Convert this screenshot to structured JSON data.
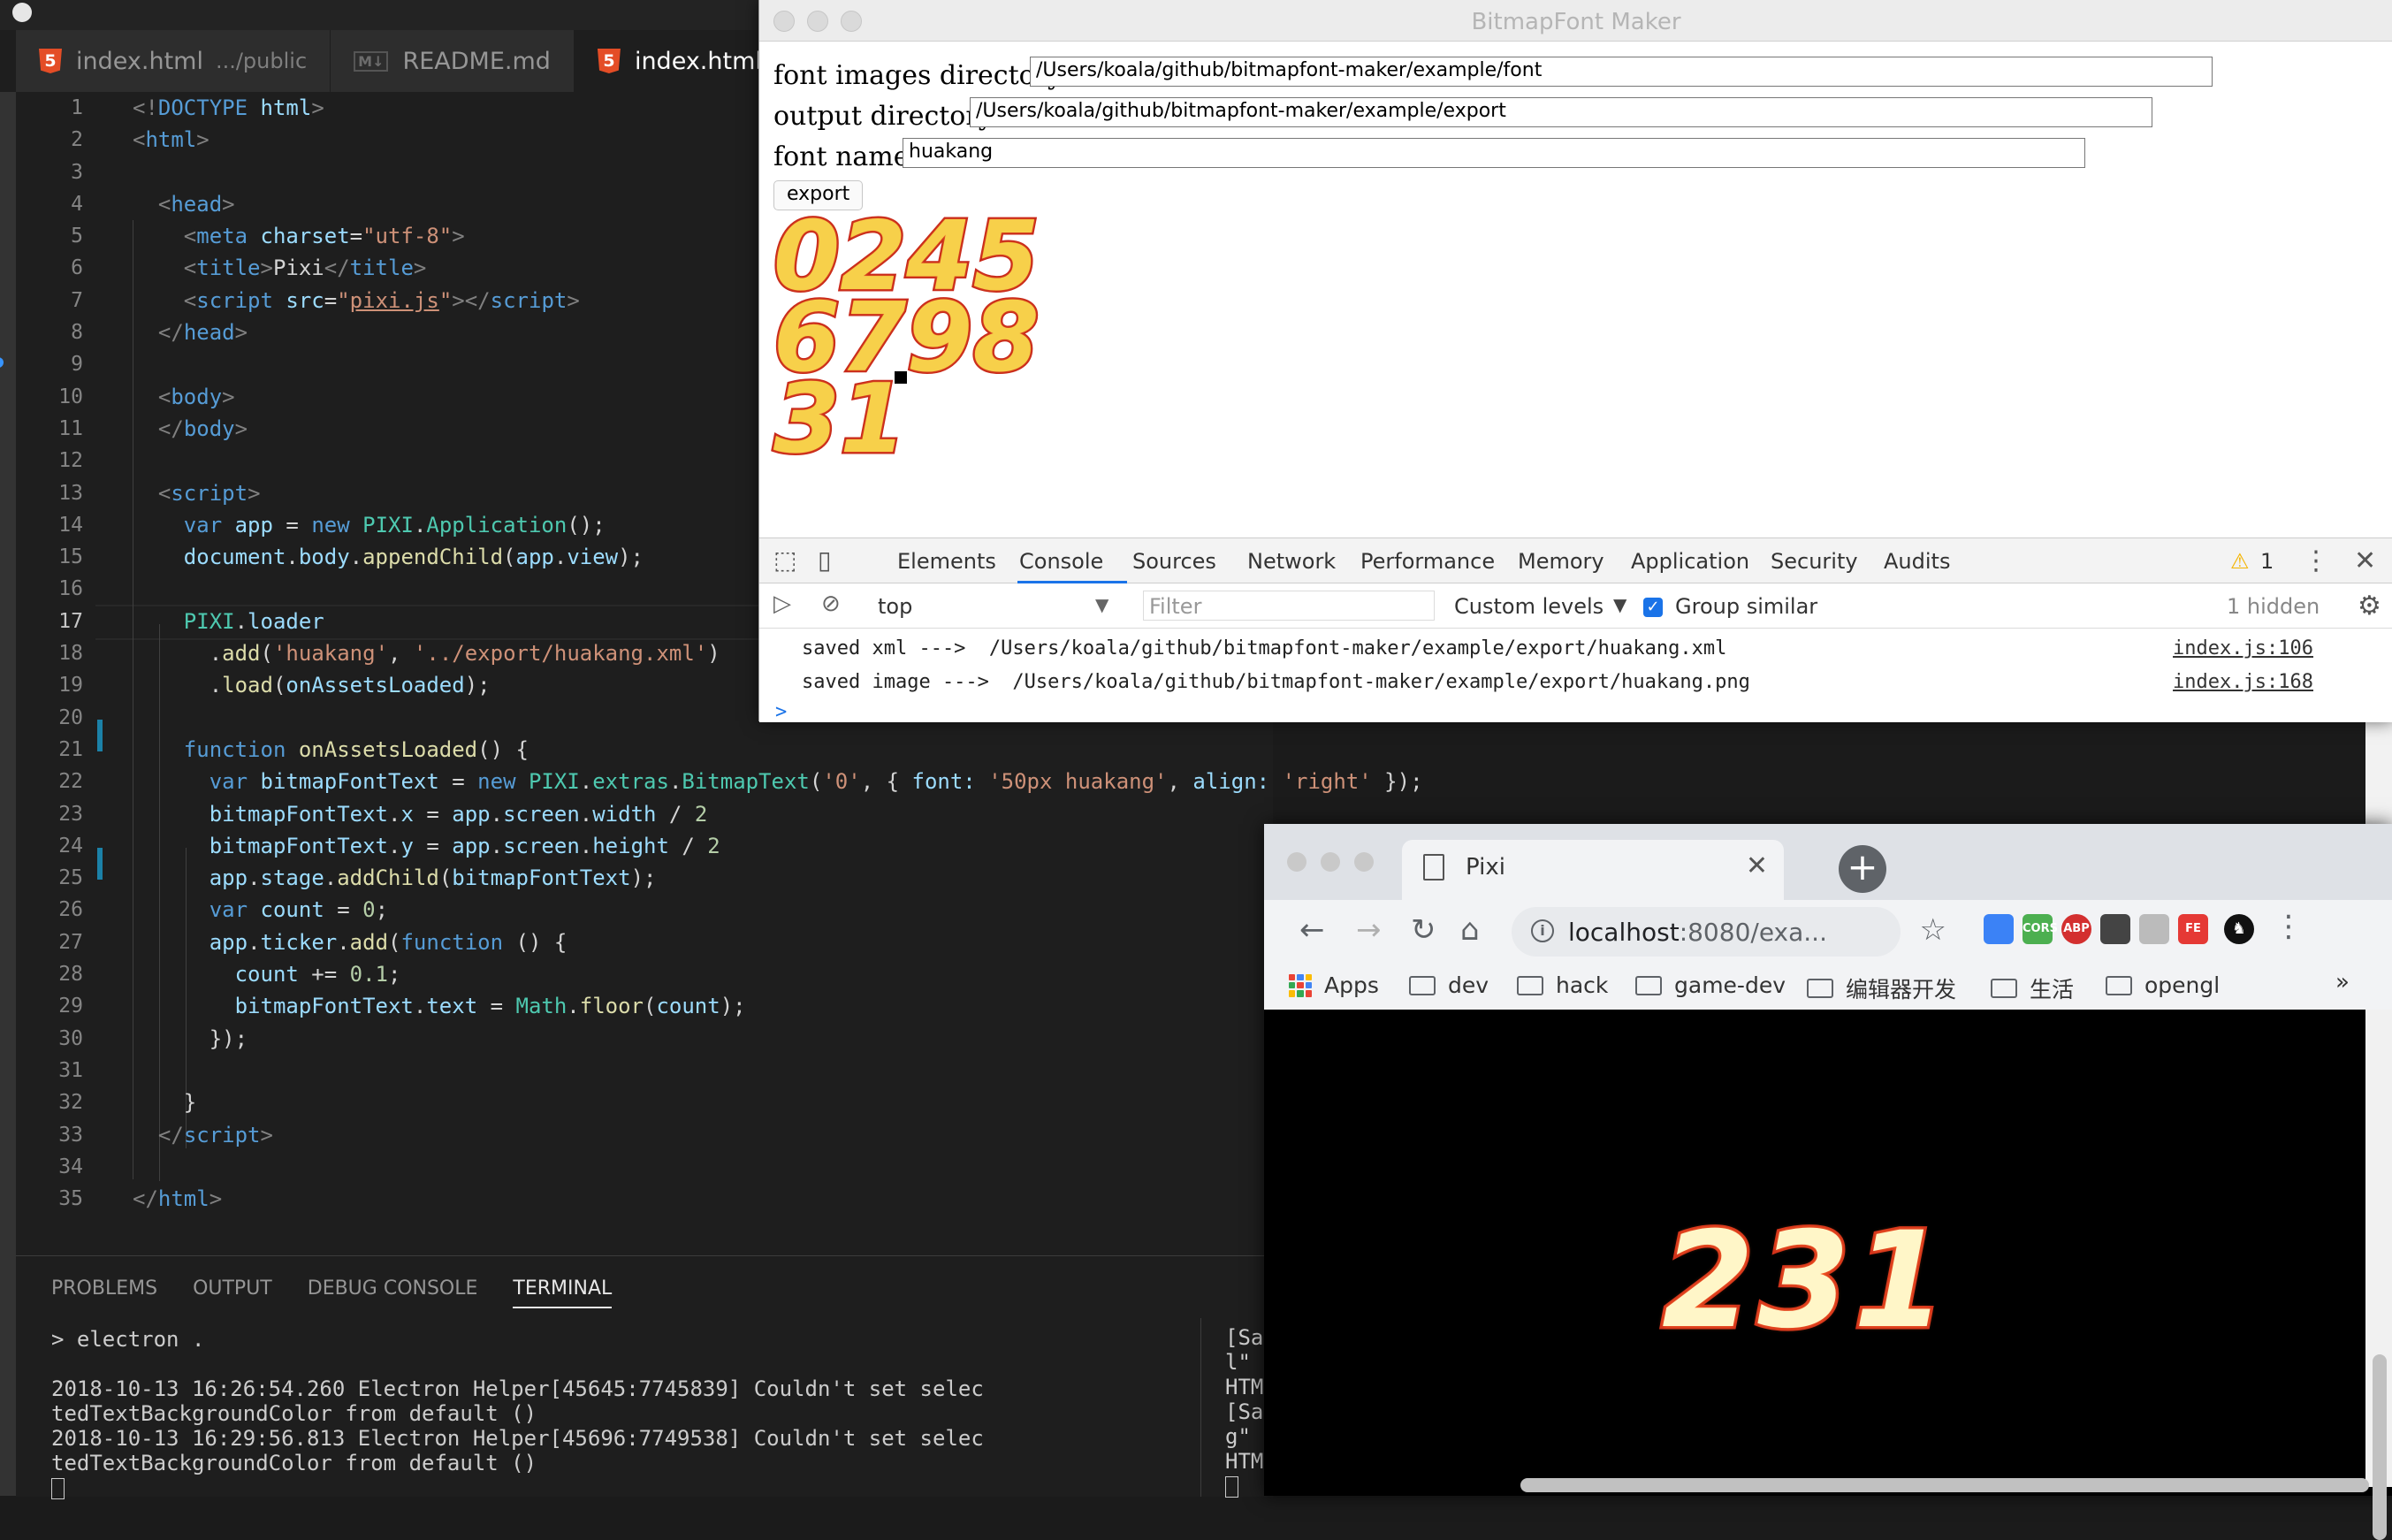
{
  "vscode": {
    "tabs": [
      {
        "label": "index.html",
        "desc": ".../public",
        "icon": "html5-icon",
        "active": false
      },
      {
        "label": "README.md",
        "desc": "",
        "icon": "markdown-icon",
        "active": false
      },
      {
        "label": "index.html",
        "desc": "",
        "icon": "html5-icon",
        "active": true
      }
    ],
    "current_line": 17,
    "panel_tabs": [
      "PROBLEMS",
      "OUTPUT",
      "DEBUG CONSOLE",
      "TERMINAL"
    ],
    "panel_active": "TERMINAL",
    "terminal_lines": [
      "> electron .",
      "",
      "2018-10-13 16:26:54.260 Electron Helper[45645:7745839] Couldn't set selec",
      "tedTextBackgroundColor from default ()",
      "2018-10-13 16:29:56.813 Electron Helper[45696:7749538] Couldn't set selec",
      "tedTextBackgroundColor from default ()"
    ],
    "terminal2_lines": [
      "[Sa",
      "l\" ",
      "HTM",
      "[Sa",
      "g\" ",
      "HTM"
    ]
  },
  "bfm": {
    "title": "BitmapFont Maker",
    "font_dir_label": "font images directory:",
    "font_dir_value": "/Users/koala/github/bitmapfont-maker/example/font",
    "output_dir_label": "output directory:",
    "output_dir_value": "/Users/koala/github/bitmapfont-maker/example/export",
    "font_name_label": "font name:",
    "font_name_value": "huakang",
    "export_label": "export",
    "glyph_rows": [
      "0245",
      "6798",
      "31"
    ]
  },
  "devtools": {
    "tabs": [
      "Elements",
      "Console",
      "Sources",
      "Network",
      "Performance",
      "Memory",
      "Application",
      "Security",
      "Audits"
    ],
    "active_tab": "Console",
    "warning_count": "1",
    "context": "top",
    "filter_placeholder": "Filter",
    "levels": "Custom levels",
    "group_similar": "Group similar",
    "hidden": "1 hidden",
    "logs": [
      {
        "text": "saved xml --->  /Users/koala/github/bitmapfont-maker/example/export/huakang.xml",
        "src": "index.js:106"
      },
      {
        "text": "saved image --->  /Users/koala/github/bitmapfont-maker/example/export/huakang.png",
        "src": "index.js:168"
      }
    ],
    "prompt": ">"
  },
  "chrome": {
    "tab_title": "Pixi",
    "url_host": "localhost",
    "url_rest": ":8080/exa...",
    "bookmarks": [
      "Apps",
      "dev",
      "hack",
      "game-dev",
      "编辑器开发",
      "生活",
      "opengl"
    ],
    "overflow": "»",
    "extensions": [
      {
        "name": "blue-extension-icon",
        "label": "",
        "color": "#3b82f6"
      },
      {
        "name": "cors-extension-icon",
        "label": "CORS",
        "color": "#4caf50"
      },
      {
        "name": "adblock-plus-icon",
        "label": "ABP",
        "color": "#d32f2f"
      },
      {
        "name": "incognito-extension-icon",
        "label": "",
        "color": "#444444"
      },
      {
        "name": "people-extension-icon",
        "label": "",
        "color": "#bbbbbb"
      },
      {
        "name": "fe-helper-icon",
        "label": "FE",
        "color": "#e53935"
      }
    ],
    "pixi_text": "231"
  }
}
